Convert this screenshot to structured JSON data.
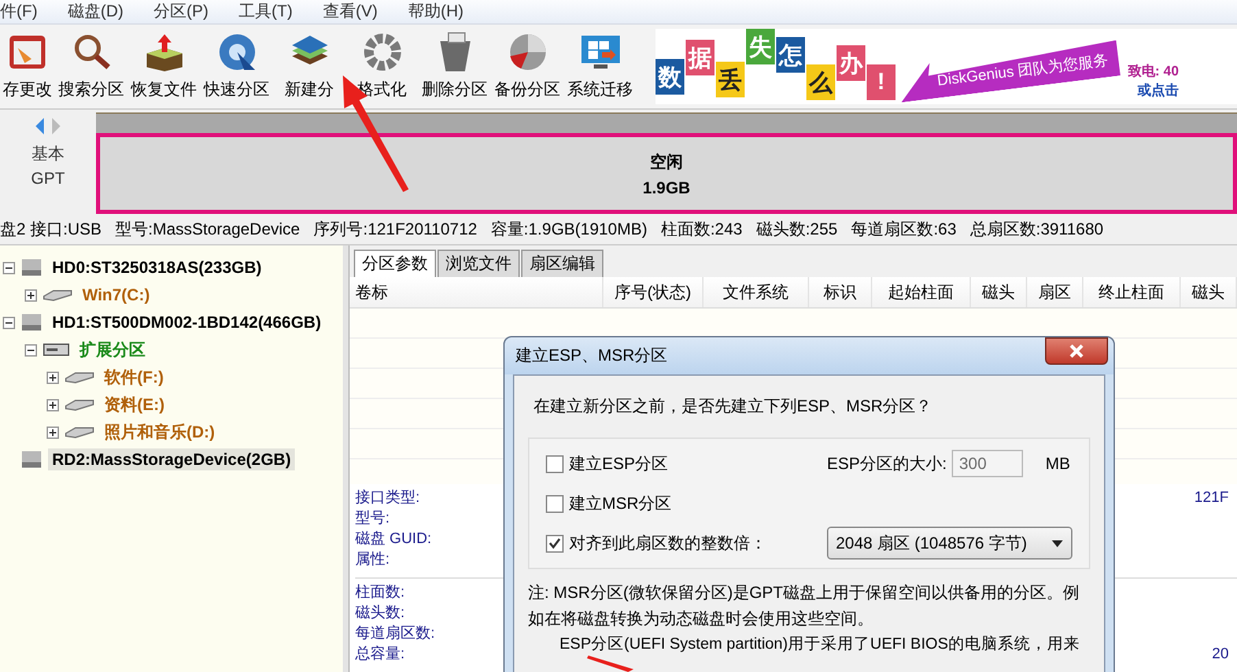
{
  "menu": [
    "件(F)",
    "磁盘(D)",
    "分区(P)",
    "工具(T)",
    "查看(V)",
    "帮助(H)"
  ],
  "toolbar": [
    {
      "label": "存更改"
    },
    {
      "label": "搜索分区"
    },
    {
      "label": "恢复文件"
    },
    {
      "label": "快速分区"
    },
    {
      "label": "新建分"
    },
    {
      "label": "格式化"
    },
    {
      "label": "删除分区"
    },
    {
      "label": "备份分区"
    },
    {
      "label": "系统迁移"
    }
  ],
  "banner": {
    "characters": [
      "数",
      "据",
      "丢",
      "失",
      "怎",
      "么",
      "办",
      "!"
    ],
    "slogan": "DiskGenius 团队为您服务",
    "phone": "致电: 40",
    "link": "或点击"
  },
  "disk_map": {
    "style": "基本",
    "table": "GPT",
    "partition": {
      "name": "空闲",
      "size": "1.9GB"
    }
  },
  "disk_info": [
    "盘2 接口:USB",
    "型号:MassStorageDevice",
    "序列号:121F20110712",
    "容量:1.9GB(1910MB)",
    "柱面数:243",
    "磁头数:255",
    "每道扇区数:63",
    "总扇区数:3911680"
  ],
  "tree": [
    {
      "label": "HD0:ST3250318AS(233GB)",
      "kind": "disk",
      "expanded": true,
      "selected": false,
      "children": [
        {
          "label": "Win7(C:)",
          "kind": "partition",
          "expanded": false,
          "selected": false
        }
      ]
    },
    {
      "label": "HD1:ST500DM002-1BD142(466GB)",
      "kind": "disk",
      "expanded": true,
      "selected": false,
      "children": [
        {
          "label": "扩展分区",
          "kind": "extended",
          "expanded": true,
          "selected": false,
          "children": [
            {
              "label": "软件(F:)",
              "kind": "partition",
              "expanded": false,
              "selected": false
            },
            {
              "label": "资料(E:)",
              "kind": "partition",
              "expanded": false,
              "selected": false
            },
            {
              "label": "照片和音乐(D:)",
              "kind": "partition",
              "expanded": false,
              "selected": false
            }
          ]
        }
      ]
    },
    {
      "label": "RD2:MassStorageDevice(2GB)",
      "kind": "disk",
      "selected": true
    }
  ],
  "tabs": [
    {
      "label": "分区参数",
      "selected": true
    },
    {
      "label": "浏览文件",
      "selected": false
    },
    {
      "label": "扇区编辑",
      "selected": false
    }
  ],
  "table": {
    "columns": [
      "卷标",
      "序号(状态)",
      "文件系统",
      "标识",
      "起始柱面",
      "磁头",
      "扇区",
      "终止柱面",
      "磁头"
    ]
  },
  "details": [
    {
      "rows": [
        {
          "label": "接口类型:",
          "value": "121F"
        },
        {
          "label": "型号:"
        },
        {
          "label": "磁盘 GUID:"
        },
        {
          "label": "属性:"
        }
      ]
    },
    {
      "rows": [
        {
          "label": "柱面数:"
        },
        {
          "label": "磁头数:"
        },
        {
          "label": "每道扇区数:"
        },
        {
          "label": "总容量:",
          "value": "20"
        }
      ]
    }
  ],
  "dialog": {
    "title": "建立ESP、MSR分区",
    "question": "在建立新分区之前，是否先建立下列ESP、MSR分区？",
    "esp": {
      "label": "建立ESP分区",
      "checked": false
    },
    "esp_size": {
      "label": "ESP分区的大小:",
      "value": "300",
      "unit": "MB",
      "disabled": true
    },
    "msr": {
      "label": "建立MSR分区",
      "checked": false
    },
    "align": {
      "label": "对齐到此扇区数的整数倍：",
      "checked": true,
      "value": "2048 扇区 (1048576 字节)"
    },
    "notes": [
      "注: MSR分区(微软保留分区)是GPT磁盘上用于保留空间以供备用的分区。例如在将磁盘转换为动态磁盘时会使用这些空间。",
      "ESP分区(UEFI System partition)用于采用了UEFI BIOS的电脑系统，用来"
    ]
  }
}
